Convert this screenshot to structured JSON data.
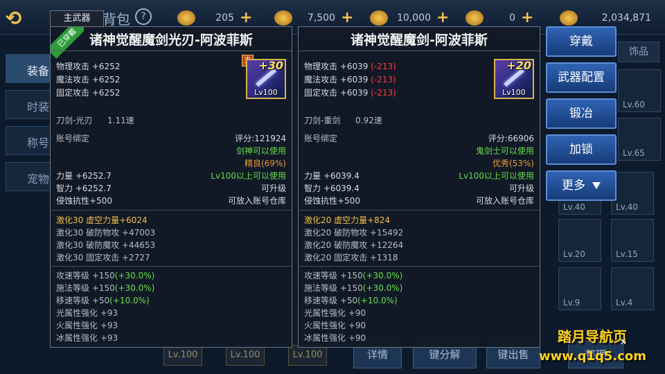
{
  "background": {
    "title": "背包",
    "currencies": [
      {
        "icon": "gem-icon",
        "value": "205"
      },
      {
        "icon": "ticket-icon",
        "value": "7,500"
      },
      {
        "icon": "hat-icon",
        "value": "10,000"
      },
      {
        "icon": "coin-icon",
        "value": "0"
      },
      {
        "icon": "gold-icon",
        "value": "2,034,871"
      }
    ],
    "side_tabs": [
      "装备",
      "时装",
      "称号",
      "宠物"
    ],
    "grid_labels": [
      "Lv.60",
      "Lv.65",
      "Lv.40",
      "Lv.40",
      "Lv.20",
      "Lv.15",
      "Lv.9",
      "Lv.4"
    ],
    "bottom_slots": [
      "Lv.100",
      "Lv.100",
      "Lv.100"
    ],
    "bottom_buttons": [
      "详情",
      "键分解",
      "键出售",
      "整理"
    ],
    "partial_tab_label": "饰品"
  },
  "main_tab": "主武器",
  "left_item": {
    "ribbon": "已穿戴",
    "name": "诸神觉醒魔剑光刃-阿波菲斯",
    "badge": "主",
    "plus": "+30",
    "icon_level": "Lv100",
    "base_stats": [
      "物理攻击 +6252",
      "魔法攻击 +6252",
      "固定攻击 +6252"
    ],
    "weapon_type": "刀剑-光刃",
    "speed": "1.11速",
    "bind": "账号绑定",
    "score": "评分:121924",
    "usable_class": "剑神可以使用",
    "quality": "精良(69%)",
    "str": "力量 +6252.7",
    "int": "智力 +6252.7",
    "corrosion": "侵蚀抗性+500",
    "level_req": "Lv100以上可以使用",
    "upgradable": "可升级",
    "storage": "可放入账号仓库",
    "awaken_main": "激化30 虚空力量+6024",
    "awaken_list": [
      "激化30 破防物攻 +47003",
      "激化30 破防魔攻 +44653",
      "激化30 固定攻击 +2727"
    ],
    "speed_stats": [
      {
        "base": "攻速等级 +150",
        "bonus": "(+30.0%)"
      },
      {
        "base": "施法等级 +150",
        "bonus": "(+30.0%)"
      },
      {
        "base": "移速等级 +50",
        "bonus": "(+10.0%)"
      }
    ],
    "elements": [
      "光属性强化 +93",
      "火属性强化 +93",
      "冰属性强化 +93"
    ]
  },
  "right_item": {
    "name": "诸神觉醒魔剑-阿波菲斯",
    "plus": "+20",
    "icon_level": "Lv100",
    "base_stats": [
      {
        "text": "物理攻击 +6039",
        "diff": "(-213)"
      },
      {
        "text": "魔法攻击 +6039",
        "diff": "(-213)"
      },
      {
        "text": "固定攻击 +6039",
        "diff": "(-213)"
      }
    ],
    "weapon_type": "刀剑-重剑",
    "speed": "0.92速",
    "bind": "账号绑定",
    "score": "评分:66906",
    "usable_class": "鬼剑士可以使用",
    "quality": "优秀(53%)",
    "str": "力量 +6039.4",
    "int": "智力 +6039.4",
    "corrosion": "侵蚀抗性+500",
    "level_req": "Lv100以上可以使用",
    "upgradable": "可升级",
    "storage": "可放入账号仓库",
    "awaken_main": "激化20 虚空力量+824",
    "awaken_list": [
      "激化20 破防物攻 +15492",
      "激化20 破防魔攻 +12264",
      "激化20 固定攻击 +1318"
    ],
    "speed_stats": [
      {
        "base": "攻速等级 +150",
        "bonus": "(+30.0%)"
      },
      {
        "base": "施法等级 +150",
        "bonus": "(+30.0%)"
      },
      {
        "base": "移速等级 +50",
        "bonus": "(+10.0%)"
      }
    ],
    "elements": [
      "光属性强化 +90",
      "火属性强化 +90",
      "冰属性强化 +90"
    ]
  },
  "actions": {
    "wear": "穿戴",
    "weapon_config": "武器配置",
    "forge": "锻冶",
    "lock": "加锁",
    "more": "更多"
  },
  "watermark": {
    "line1": "踏月导航页",
    "line2": "www.q1q5.com",
    "close": "x"
  },
  "colors": {
    "gold": "#f1c14b",
    "green": "#66e04a",
    "red": "#ff3d3d",
    "orange": "#e89a3c",
    "button_blue": "#2f64b4"
  }
}
